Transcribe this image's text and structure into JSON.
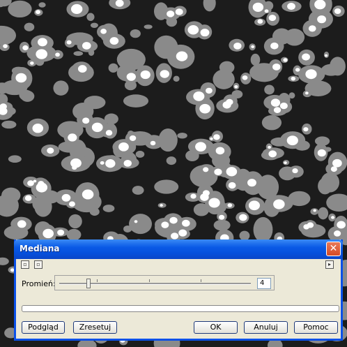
{
  "image": {
    "description_icon": "binary-noise-image",
    "background": "#1c1c1c",
    "gray": "#8a8a8a",
    "white": "#ffffff"
  },
  "dialog": {
    "title": "Mediana",
    "close_label": "✕",
    "toolbar": {
      "icon1": "collapse-icon",
      "icon2": "restore-icon",
      "icon_right": "arrow-right-icon"
    },
    "radius_label": "Promień:",
    "radius_value": "4",
    "buttons": {
      "preview": "Podgląd",
      "reset": "Zresetuj",
      "ok": "OK",
      "cancel": "Anuluj",
      "help": "Pomoc"
    }
  }
}
